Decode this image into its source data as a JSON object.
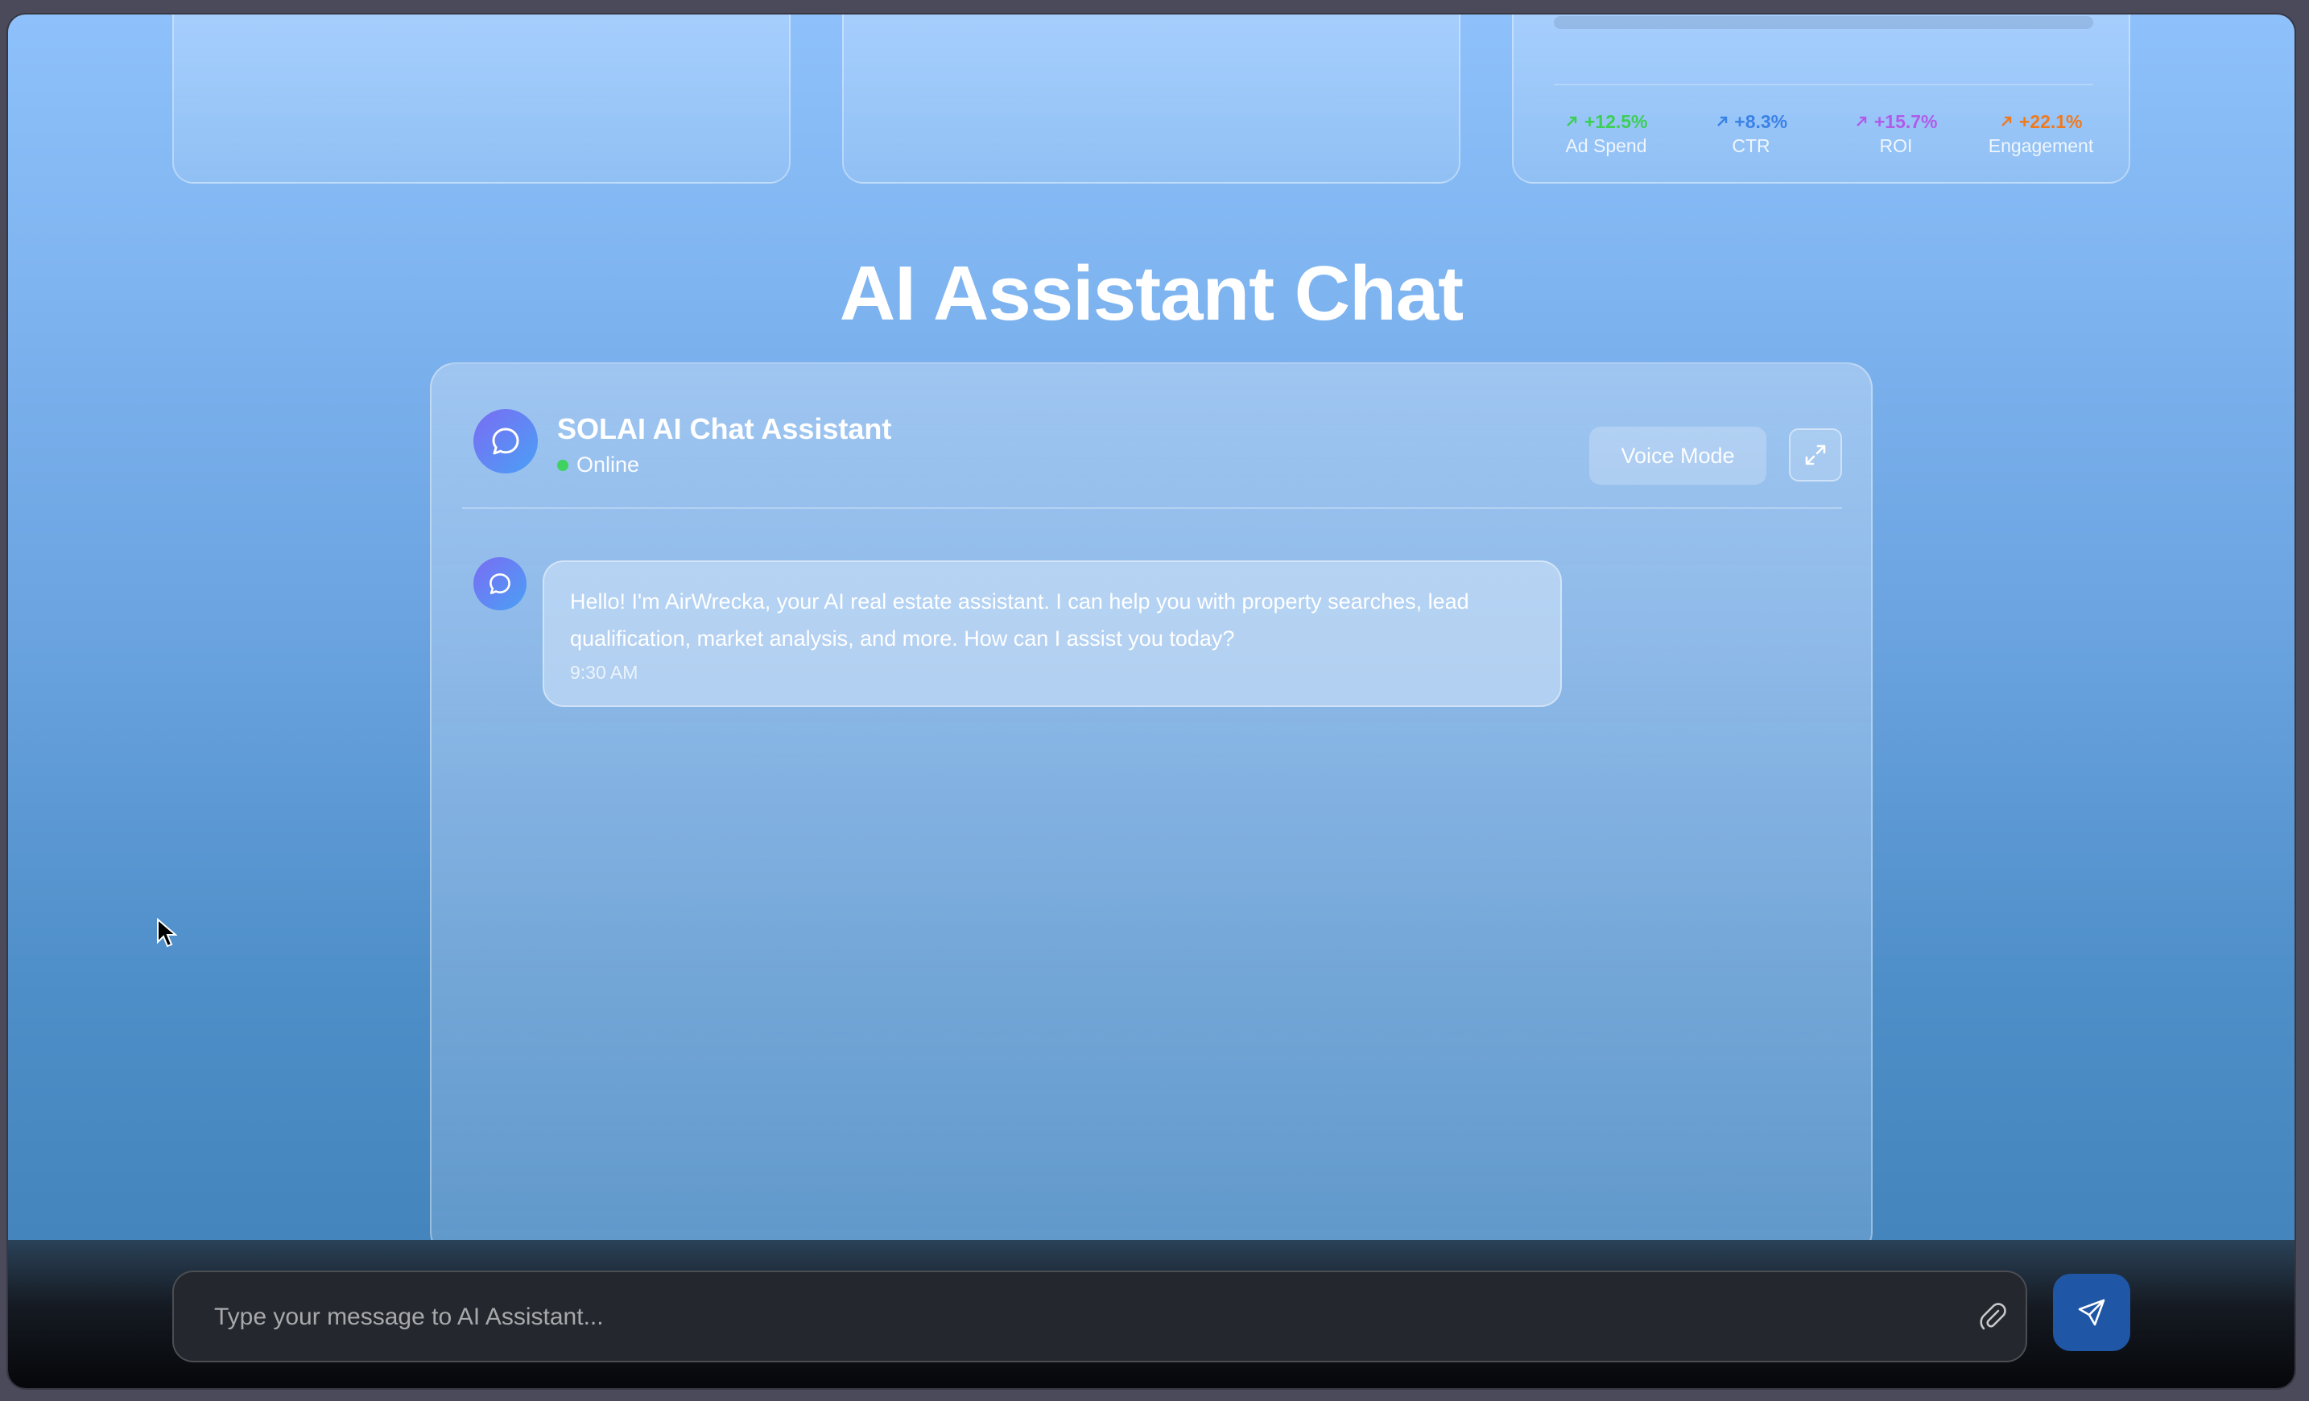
{
  "metrics": [
    {
      "value": "+12.5%",
      "label": "Ad Spend",
      "color": "#3ccf55"
    },
    {
      "value": "+8.3%",
      "label": "CTR",
      "color": "#3b82e6"
    },
    {
      "value": "+15.7%",
      "label": "ROI",
      "color": "#b05ce8"
    },
    {
      "value": "+22.1%",
      "label": "Engagement",
      "color": "#f07a1e"
    }
  ],
  "page_title": "AI Assistant Chat",
  "chat": {
    "assistant_name": "SOLAI AI Chat Assistant",
    "status": "Online",
    "voice_mode_label": "Voice Mode",
    "messages": [
      {
        "text": "Hello! I'm AirWrecka, your AI real estate assistant. I can help you with property searches, lead qualification, market analysis, and more. How can I assist you today?",
        "time": "9:30 AM"
      }
    ]
  },
  "input": {
    "placeholder": "Type your message to AI Assistant...",
    "value": ""
  },
  "icons": {
    "avatar": "chat-bubble-icon",
    "expand": "expand-icon",
    "attach": "paperclip-icon",
    "send": "send-icon",
    "metric_trend": "arrow-up-right-icon"
  }
}
